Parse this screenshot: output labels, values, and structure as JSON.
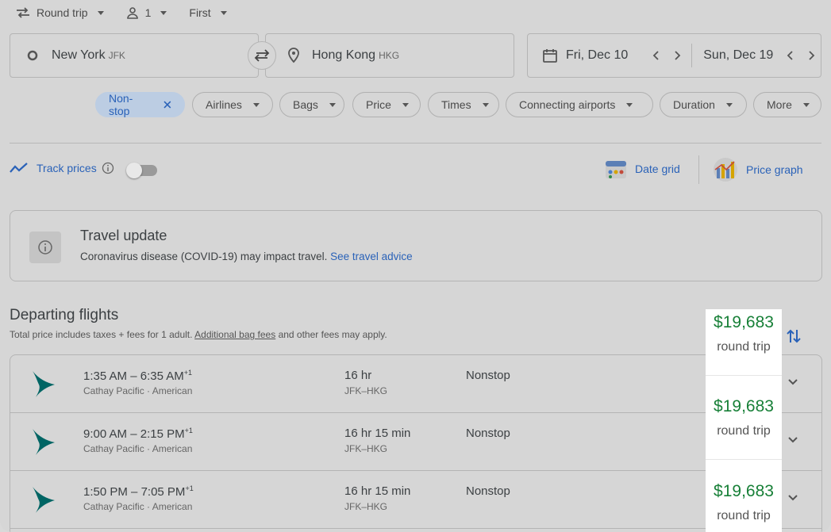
{
  "search": {
    "trip_type": "Round trip",
    "passengers": "1",
    "cabin": "First",
    "origin_city": "New York",
    "origin_code": "JFK",
    "destination_city": "Hong Kong",
    "destination_code": "HKG",
    "depart_date": "Fri, Dec 10",
    "return_date": "Sun, Dec 19"
  },
  "filters": [
    {
      "label": "Non-stop",
      "active": true
    },
    {
      "label": "Airlines"
    },
    {
      "label": "Bags"
    },
    {
      "label": "Price"
    },
    {
      "label": "Times"
    },
    {
      "label": "Connecting airports"
    },
    {
      "label": "Duration"
    },
    {
      "label": "More"
    }
  ],
  "tools": {
    "track_prices": "Track prices",
    "date_grid": "Date grid",
    "price_graph": "Price graph"
  },
  "travel_update": {
    "title": "Travel update",
    "message": "Coronavirus disease (COVID-19) may impact travel.",
    "link": "See travel advice"
  },
  "departing": {
    "title": "Departing flights",
    "subtitle_pre": "Total price includes taxes + fees for 1 adult.",
    "subtitle_link": "Additional bag fees",
    "subtitle_post": "and other fees may apply."
  },
  "flights": [
    {
      "depart": "1:35 AM",
      "arrive": "6:35 AM",
      "day_offset": "+1",
      "airline": "Cathay Pacific · American",
      "duration": "16 hr",
      "route": "JFK–HKG",
      "stops": "Nonstop",
      "price": "$19,683",
      "price_note": "round trip"
    },
    {
      "depart": "9:00 AM",
      "arrive": "2:15 PM",
      "day_offset": "+1",
      "airline": "Cathay Pacific · American",
      "duration": "16 hr 15 min",
      "route": "JFK–HKG",
      "stops": "Nonstop",
      "price": "$19,683",
      "price_note": "round trip"
    },
    {
      "depart": "1:50 PM",
      "arrive": "7:05 PM",
      "day_offset": "+1",
      "airline": "Cathay Pacific · American",
      "duration": "16 hr 15 min",
      "route": "JFK–HKG",
      "stops": "Nonstop",
      "price": "$19,683",
      "price_note": "round trip"
    }
  ],
  "colors": {
    "price_green": "#188038",
    "link_blue": "#2a62b8",
    "airline_teal": "#006564"
  },
  "icons": [
    "round-trip-icon",
    "person-icon",
    "origin-circle-icon",
    "swap-icon",
    "location-pin-icon",
    "calendar-icon",
    "chevron-left-icon",
    "chevron-right-icon",
    "clear-x-icon",
    "trend-icon",
    "info-icon",
    "date-grid-icon",
    "price-graph-icon",
    "sort-icon",
    "expand-chevron-icon",
    "cathay-pacific-logo"
  ]
}
